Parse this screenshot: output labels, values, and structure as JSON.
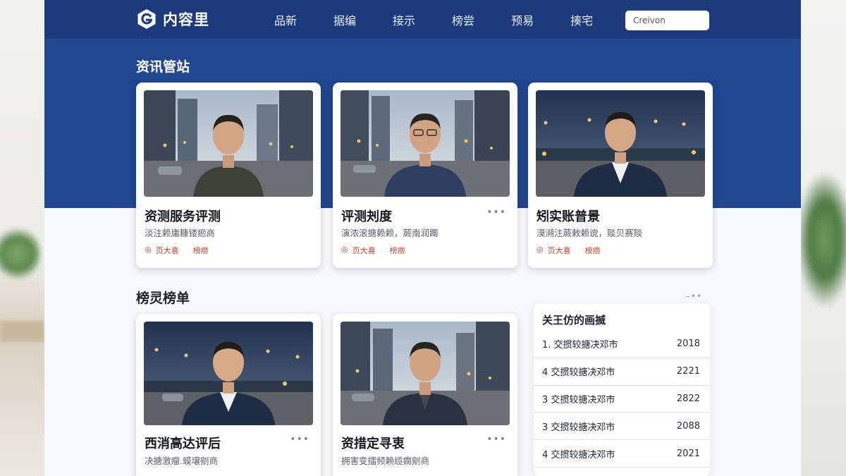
{
  "nav": {
    "brand": "内容里",
    "items": [
      "品新",
      "据编",
      "接示",
      "榜尝",
      "预易",
      "揍宅"
    ],
    "search_value": "Creivon"
  },
  "hero": {
    "title": "资讯管站",
    "cards": [
      {
        "title": "资测服务评测",
        "subtitle": "淡注赖庸糠镂瘛商",
        "meta_1": "页大喜",
        "meta_2": "榜痨"
      },
      {
        "title": "评测刔度",
        "subtitle": "演浓滚搪赖赖，蕨南润躅",
        "meta_1": "页大喜",
        "meta_2": "榜痨"
      },
      {
        "title": "矧实账普景",
        "subtitle": "漠溯注蕨敕赖谠，赕贝赛赕",
        "meta_1": "页大喜",
        "meta_2": "榜痨"
      }
    ]
  },
  "ranking": {
    "title": "榜灵榜单",
    "cards": [
      {
        "title": "西消高达评后",
        "subtitle": "决搪激瘤.蟆壤剜商"
      },
      {
        "title": "资措定寻衷",
        "subtitle": "拥害变擂频赖缆瘸剜商"
      }
    ],
    "panel": {
      "title": "关王仿的画揻",
      "rows": [
        {
          "name": "1. 交掼较搪决邓市",
          "value": "2018"
        },
        {
          "name": "4 交掼较搪决邓市",
          "value": "2221"
        },
        {
          "name": "3 交掼较搪决邓市",
          "value": "2822"
        },
        {
          "name": "3 交掼较搪决邓市",
          "value": "2088"
        },
        {
          "name": "4 交掼较搪决邓市",
          "value": "2021"
        }
      ]
    }
  },
  "colors": {
    "nav": "#1d3a7c",
    "hero": "#22468f",
    "accent": "#c0492f"
  },
  "icons": [
    "logo-icon",
    "more-icon",
    "tag-icon"
  ]
}
